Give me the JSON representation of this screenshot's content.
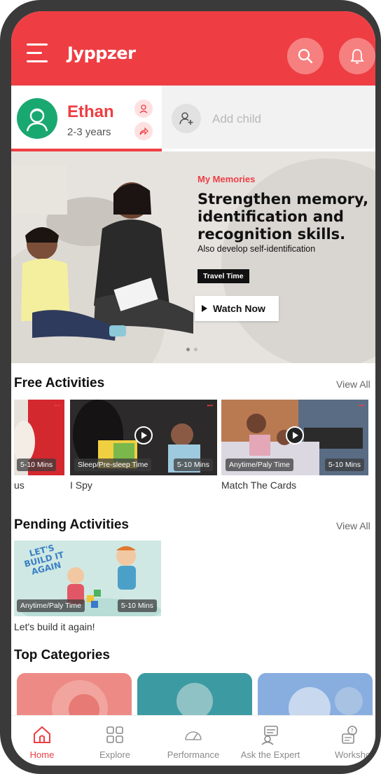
{
  "app": {
    "logo": "Jyppzer",
    "brand_color": "#ee3e43"
  },
  "header": {
    "menu_icon": "hamburger-icon",
    "search_icon": "search-icon",
    "notification_icon": "bell-icon"
  },
  "child_selector": {
    "active_child": {
      "name": "Ethan",
      "age": "2-3 years"
    },
    "add_child_label": "Add child"
  },
  "banner": {
    "tag": "My Memories",
    "heading": "Strengthen memory, identification and recognition skills.",
    "subheading": "Also develop self-identification",
    "pill": "Travel Time",
    "cta": "Watch Now",
    "slides": 2,
    "active_slide": 1
  },
  "free_activities": {
    "title": "Free Activities",
    "view_all": "View All",
    "cards": [
      {
        "caption": "us",
        "time": "5-10 Mins",
        "category": ""
      },
      {
        "caption": "I Spy",
        "time": "5-10 Mins",
        "category": "Sleep/Pre-sleep Time"
      },
      {
        "caption": "Match The Cards",
        "time": "5-10 Mins",
        "category": "Anytime/Paly Time"
      }
    ]
  },
  "pending_activities": {
    "title": "Pending Activities",
    "view_all": "View All",
    "cards": [
      {
        "caption": "Let's build it again!",
        "time": "5-10 Mins",
        "category": "Anytime/Paly Time",
        "art_text": "LET'S BUILD IT AGAIN"
      }
    ]
  },
  "top_categories": {
    "title": "Top Categories"
  },
  "bottom_nav": {
    "items": [
      {
        "label": "Home",
        "icon": "home-icon",
        "active": true
      },
      {
        "label": "Explore",
        "icon": "grid-icon",
        "active": false
      },
      {
        "label": "Performance",
        "icon": "gauge-icon",
        "active": false
      },
      {
        "label": "Ask the Expert",
        "icon": "expert-icon",
        "active": false
      },
      {
        "label": "Workshop",
        "icon": "workshop-icon",
        "active": false
      }
    ]
  }
}
